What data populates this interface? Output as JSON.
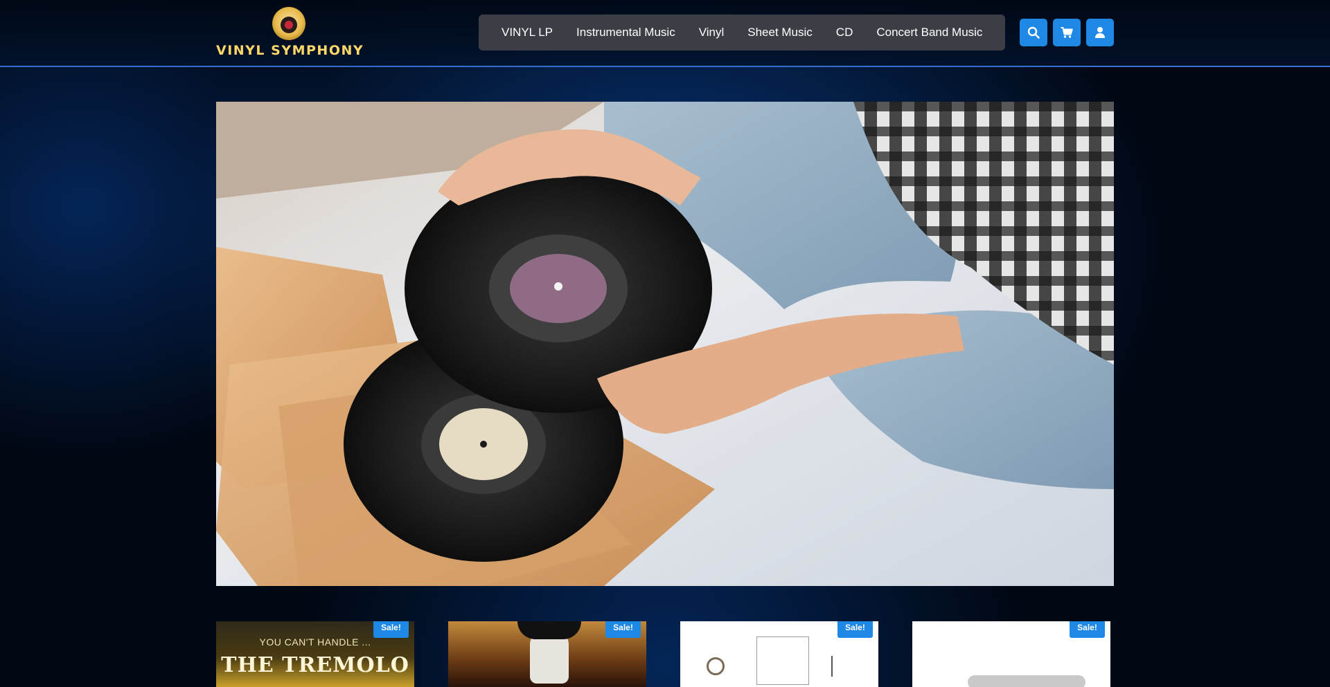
{
  "brand": {
    "name": "VINYL SYMPHONY"
  },
  "nav": {
    "items": [
      {
        "label": "VINYL LP"
      },
      {
        "label": "Instrumental Music"
      },
      {
        "label": "Vinyl"
      },
      {
        "label": "Sheet Music"
      },
      {
        "label": "CD"
      },
      {
        "label": "Concert Band Music"
      }
    ]
  },
  "header_actions": {
    "search_icon": "search-icon",
    "cart_icon": "cart-icon",
    "account_icon": "user-icon"
  },
  "colors": {
    "accent": "#1e88e5",
    "nav_bg": "#3b3f45",
    "brand_gold": "#ffd86a",
    "header_border": "#2f6fd1"
  },
  "hero": {
    "image": "hands holding vinyl records on a bed"
  },
  "products": [
    {
      "badge": "Sale!",
      "cover_text_1": "YOU CAN'T HANDLE ...",
      "cover_text_2": "THE TREMOLO"
    },
    {
      "badge": "Sale!"
    },
    {
      "badge": "Sale!"
    },
    {
      "badge": "Sale!"
    }
  ]
}
